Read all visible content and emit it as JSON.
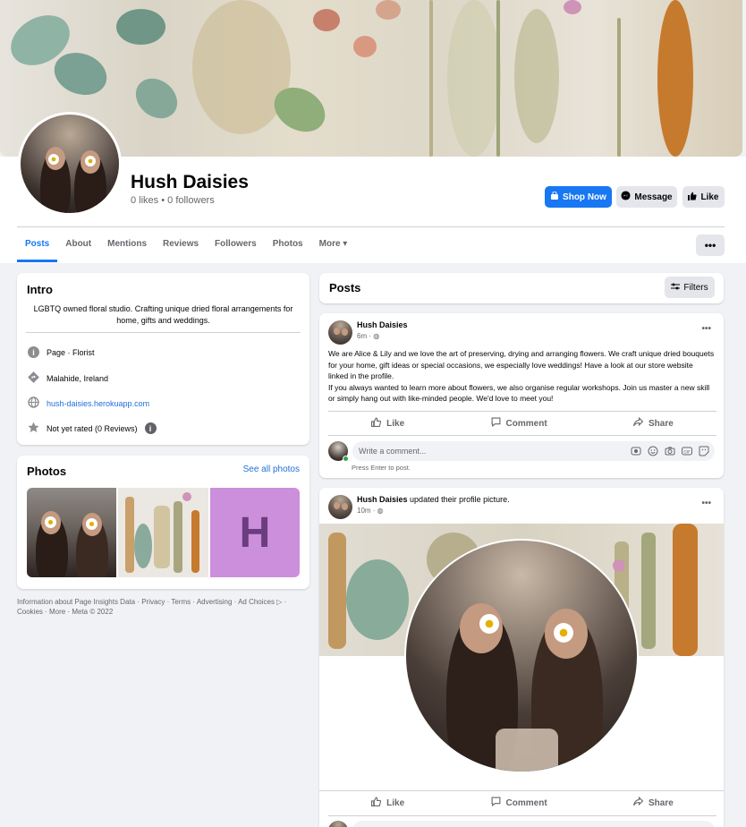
{
  "page": {
    "name": "Hush Daisies",
    "stats": "0 likes • 0 followers"
  },
  "buttons": {
    "shop_now": "Shop Now",
    "message": "Message",
    "like": "Like",
    "more_dots": "•••"
  },
  "tabs": [
    {
      "label": "Posts",
      "active": true
    },
    {
      "label": "About"
    },
    {
      "label": "Mentions"
    },
    {
      "label": "Reviews"
    },
    {
      "label": "Followers"
    },
    {
      "label": "Photos"
    },
    {
      "label": "More ▾"
    }
  ],
  "intro": {
    "title": "Intro",
    "bio": "LGBTQ owned floral studio. Crafting unique dried floral arrangements for home, gifts and weddings.",
    "category": "Page · Florist",
    "location": "Malahide, Ireland",
    "website": "hush-daisies.herokuapp.com",
    "rating": "Not yet rated (0 Reviews)"
  },
  "photos": {
    "title": "Photos",
    "see_all": "See all photos",
    "letter_tile": "H"
  },
  "footer": "Information about Page Insights Data · Privacy · Terms · Advertising · Ad Choices ▷ · Cookies · More · Meta © 2022",
  "posts_header": {
    "title": "Posts",
    "filters": "Filters"
  },
  "post1": {
    "author": "Hush Daisies",
    "time": "6m · ◍",
    "text1": "We are Alice & Lily and we love the art of preserving, drying and arranging flowers. We craft unique dried bouquets for your home, gift ideas or special occasions, we especially love weddings! Have a look at our store website linked in the profile.",
    "text2": "If you always wanted to learn more about flowers, we also organise regular workshops. Join us master a new skill or simply hang out with like-minded people. We'd love to meet you!",
    "like": "Like",
    "comment": "Comment",
    "share": "Share",
    "comment_placeholder": "Write a comment...",
    "press_enter": "Press Enter to post."
  },
  "post2": {
    "author": "Hush Daisies",
    "action": "updated their profile picture.",
    "time": "10m · ◍",
    "like": "Like",
    "comment": "Comment",
    "share": "Share"
  },
  "colors": {
    "brand_blue": "#1877f2",
    "background": "#f0f2f5",
    "tile_purple": "#cc8fdb"
  }
}
